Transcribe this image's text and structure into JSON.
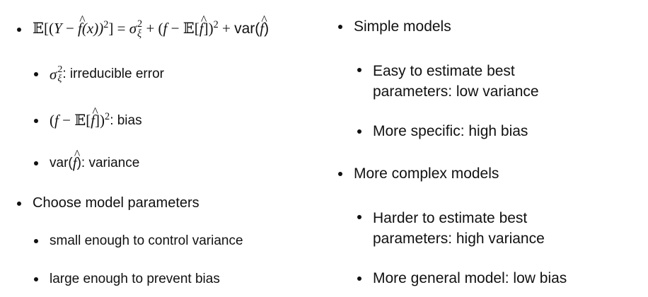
{
  "left": {
    "formula": {
      "E": "𝔼",
      "lb": "[(",
      "Y": "Y",
      "minus": " − ",
      "fx": "f",
      "x": "(x))",
      "sq": "2",
      "rb": "] = ",
      "sigma": "σ",
      "sig_sup": "2",
      "sig_sub": "ξ",
      "plus1": " + (",
      "f": "f",
      "minus2": " − ",
      "E2": "𝔼",
      "lb2": "[",
      "fh": "f",
      "rb2": "])",
      "sq2": "2",
      "plus2": " + ",
      "var": "var(",
      "fh2": "f",
      "rp": ")"
    },
    "irreducible": {
      "sigma": "σ",
      "sup": "2",
      "sub": "ξ",
      "text": ": irreducible error"
    },
    "bias": {
      "lp": "(",
      "f": "f",
      "minus": " − ",
      "E": "𝔼",
      "lb": "[",
      "fh": "f",
      "rb": "])",
      "sup": "2",
      "text": ": bias"
    },
    "variance": {
      "var": "var(",
      "fh": "f",
      "rp": ")",
      "text": ": variance"
    },
    "choose": "Choose model parameters",
    "small": "small enough to control variance",
    "large": "large enough to prevent bias"
  },
  "right": {
    "simple": "Simple models",
    "easy_1": "Easy to estimate best",
    "easy_2": "parameters: low variance",
    "specific": "More specific: high bias",
    "complex": "More complex models",
    "harder_1": "Harder to estimate best",
    "harder_2": "parameters: high variance",
    "general": "More general model: low bias"
  }
}
